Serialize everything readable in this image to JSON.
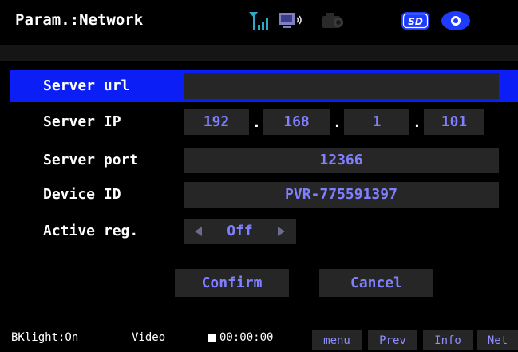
{
  "header": {
    "title": "Param.:Network",
    "status_icons": [
      "signal-icon",
      "speaker-monitor-icon",
      "camera-icon",
      "sd-card-icon",
      "record-disc-icon"
    ]
  },
  "form": {
    "server_url": {
      "label": "Server url",
      "value": ""
    },
    "server_ip": {
      "label": "Server IP",
      "octets": [
        "192",
        "168",
        "1",
        "101"
      ],
      "separator": "."
    },
    "server_port": {
      "label": "Server port",
      "value": "12366"
    },
    "device_id": {
      "label": "Device ID",
      "value": "PVR-775591397"
    },
    "active_reg": {
      "label": "Active reg.",
      "value": "Off"
    }
  },
  "buttons": {
    "confirm": "Confirm",
    "cancel": "Cancel"
  },
  "statusbar": {
    "backlight": "BKlight:On",
    "mode": "Video",
    "timer": "00:00:00",
    "softkeys": [
      "menu",
      "Prev",
      "Info",
      "Net"
    ]
  },
  "colors": {
    "selection": "#0a1ef5",
    "field_bg": "#262626",
    "value_text": "#7f7fff",
    "icon_blue": "#1e3cff"
  }
}
